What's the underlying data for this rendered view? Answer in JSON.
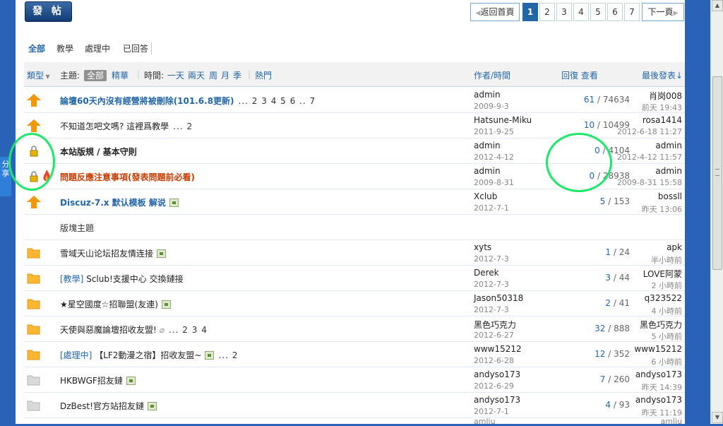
{
  "post_button": "發 帖",
  "pagination": {
    "back": "返回首頁",
    "pages": [
      "1",
      "2",
      "3",
      "4",
      "5",
      "6",
      "7"
    ],
    "active": "1",
    "next": "下一頁"
  },
  "filter_tabs": [
    "全部",
    "教學",
    "處理中",
    "已回答"
  ],
  "side_share": "分享",
  "header": {
    "type": "類型",
    "subject": "主題:",
    "all": "全部",
    "digest": "精華",
    "time": "時間:",
    "times": [
      "一天",
      "兩天",
      "周",
      "月",
      "季"
    ],
    "hot": "熱門",
    "author": "作者/時間",
    "replies_views": "回復 查看",
    "last_post": "最後發表"
  },
  "threads": [
    {
      "icon": "announce-icon",
      "color": "#f39800",
      "subject": "論壇60天內沒有經營將被刪除(101.6.8更新)",
      "style": "blue",
      "pages": "... 2  3  4  5  6 .. 7",
      "author": "admin",
      "date": "2009-9-3",
      "replies": "61",
      "views": "74634",
      "last_user": "肖岗008",
      "last_time": "前天 19:43"
    },
    {
      "icon": "announce-icon",
      "color": "#f39800",
      "subject": "不知道怎吧文嗎? 這裡爲教學",
      "style": "normal",
      "pages": "... 2",
      "author": "Hatsune-Miku",
      "date": "2011-9-25",
      "replies": "10",
      "views": "10499",
      "last_user": "rosa1414",
      "last_time": "2012-6-18 11:27"
    },
    {
      "icon": "lock-icon",
      "color": "#e8b300",
      "subject": "本站版規 / 基本守則",
      "style": "bold",
      "author": "admin",
      "date": "2012-4-12",
      "replies": "0",
      "views": "4104",
      "last_user": "admin",
      "last_time": "2012-4-12 11:57"
    },
    {
      "icon": "lock-icon",
      "color": "#e8b300",
      "subject": "問題反應注意事項(發表問題前必看)",
      "style": "red",
      "hot": true,
      "author": "admin",
      "date": "2009-8-31",
      "replies": "0",
      "views": "28938",
      "last_user": "admin",
      "last_time": "2009-8-31 15:58"
    },
    {
      "icon": "announce-icon",
      "color": "#f39800",
      "subject": "Discuz-7.x 默认模板 解说",
      "style": "blue",
      "img": true,
      "author": "Xclub",
      "date": "2012-7-1",
      "replies": "5",
      "views": "153",
      "last_user": "bossll",
      "last_time": "昨天 13:06"
    }
  ],
  "section_label": "版塊主題",
  "normal_threads": [
    {
      "icon": "folder-icon",
      "color": "#fbb732",
      "subject": "雪域天山论坛招友情连接",
      "img": true,
      "author": "xyts",
      "date": "2012-7-3",
      "replies": "1",
      "views": "24",
      "last_user": "apk",
      "last_time": "半小時前"
    },
    {
      "icon": "folder-icon",
      "color": "#fbb732",
      "cat": "[教學]",
      "subject": "Sclub!支援中心 交換鏈接",
      "author": "Derek",
      "date": "2012-7-3",
      "replies": "3",
      "views": "44",
      "last_user": "LOVE阿蒙",
      "last_time": "2 小時前"
    },
    {
      "icon": "folder-icon",
      "color": "#fbb732",
      "subject": "★星空國度☆招聯盟(友連)",
      "img": true,
      "author": "Jason50318",
      "date": "2012-7-3",
      "replies": "2",
      "views": "41",
      "last_user": "q323522",
      "last_time": "4 小時前"
    },
    {
      "icon": "folder-icon",
      "color": "#fbb732",
      "subject": "天使與惡魔論壇招收友盟!",
      "clip": true,
      "pages": "... 2  3  4",
      "author": "黑色巧克力",
      "date": "2012-6-27",
      "replies": "32",
      "views": "888",
      "last_user": "黑色巧克力",
      "last_time": "5 小時前"
    },
    {
      "icon": "folder-icon",
      "color": "#fbb732",
      "cat": "[處理中]",
      "subject": "【LF2動漫之宿】招收友盟~",
      "img": true,
      "pages": "... 2",
      "author": "www15212",
      "date": "2012-6-28",
      "replies": "12",
      "views": "352",
      "last_user": "www15212",
      "last_time": "6 小時前"
    },
    {
      "icon": "folder-icon",
      "color": "#d9d9d9",
      "subject": "HKBWGF招友鏈",
      "img": true,
      "author": "andyso173",
      "date": "2012-6-29",
      "replies": "7",
      "views": "260",
      "last_user": "andyso173",
      "last_time": "昨天 14:39"
    },
    {
      "icon": "folder-icon",
      "color": "#d9d9d9",
      "subject": "DzBest!官方站招友鏈",
      "img": true,
      "author": "andyso173",
      "date": "2012-7-1",
      "replies": "4",
      "views": "93",
      "last_user": "andyso173",
      "last_time": "昨天 11:19"
    }
  ],
  "truncated_row": {
    "author": "amliu",
    "last_user": "amliu"
  }
}
